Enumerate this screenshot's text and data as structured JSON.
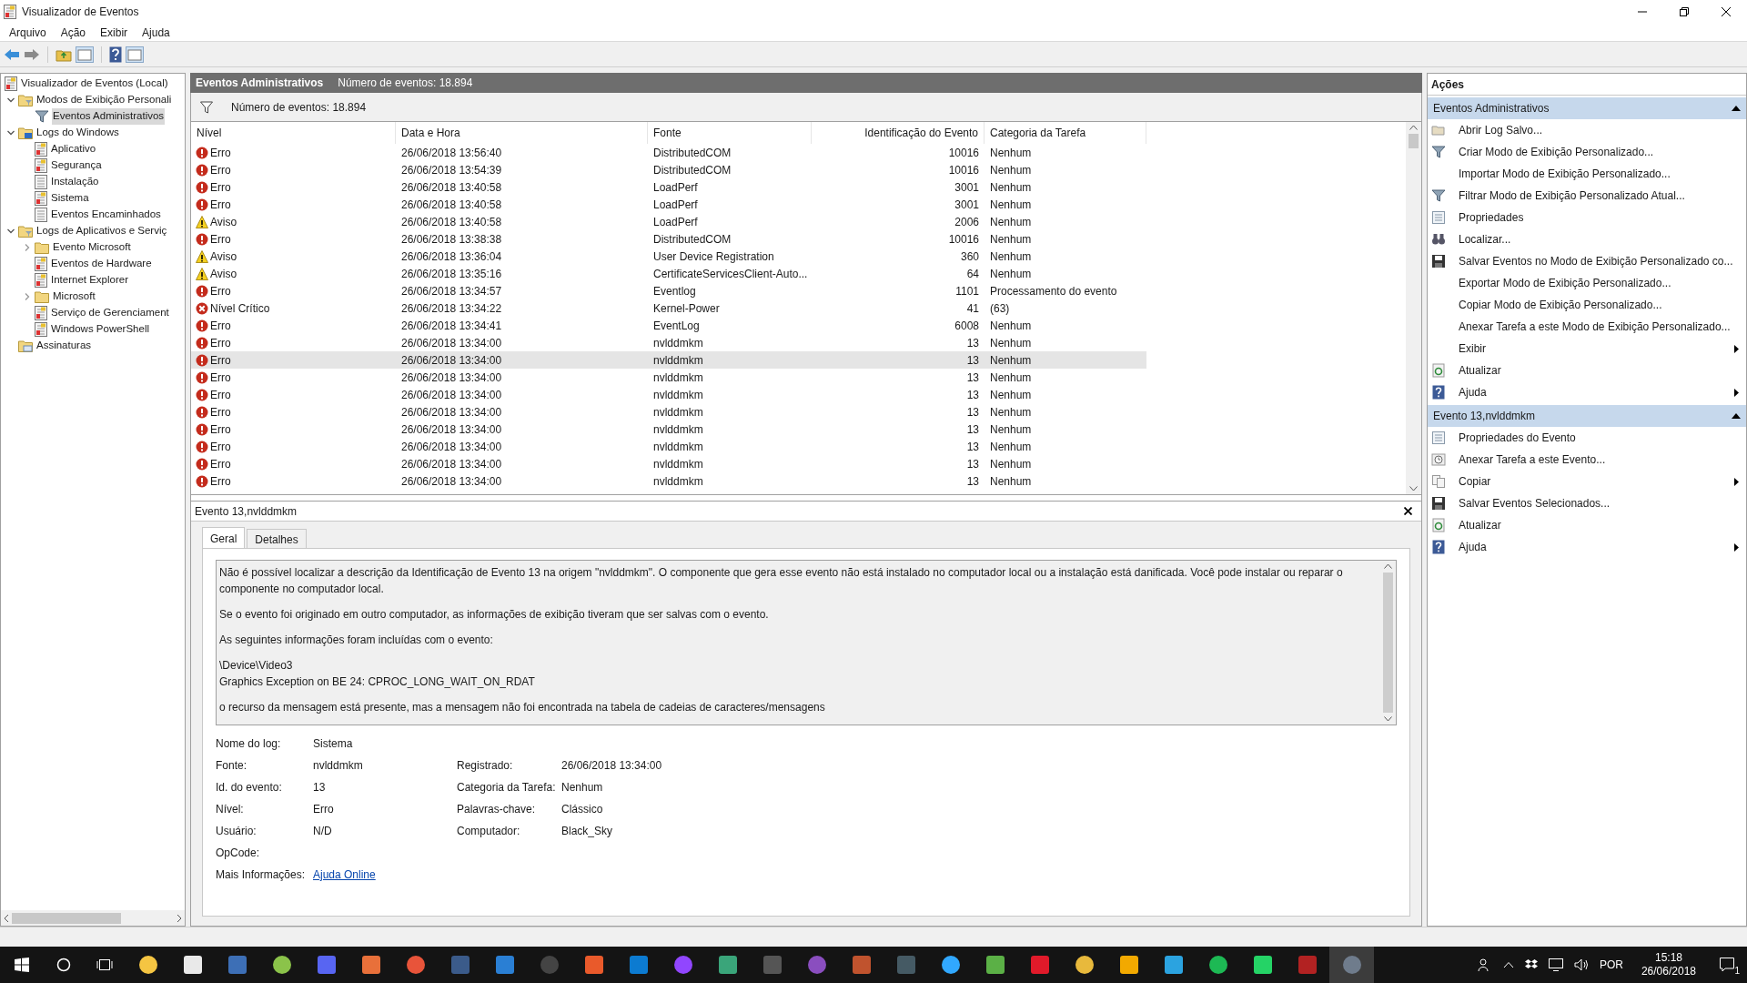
{
  "window": {
    "title": "Visualizador de Eventos"
  },
  "menu": [
    {
      "label": "Arquivo"
    },
    {
      "label": "Ação"
    },
    {
      "label": "Exibir"
    },
    {
      "label": "Ajuda"
    }
  ],
  "tree": [
    {
      "label": "Visualizador de Eventos (Local)",
      "kind": "root",
      "selected": false,
      "children": [
        {
          "label": "Modos de Exibição Personali",
          "kind": "custom-folder",
          "selected": false,
          "expanded": true,
          "children": [
            {
              "label": "Eventos Administrativos",
              "kind": "filter",
              "selected": true
            }
          ]
        },
        {
          "label": "Logs do Windows",
          "kind": "windows-folder",
          "selected": false,
          "expanded": true,
          "children": [
            {
              "label": "Aplicativo",
              "kind": "log",
              "selected": false
            },
            {
              "label": "Segurança",
              "kind": "log",
              "selected": false
            },
            {
              "label": "Instalação",
              "kind": "plain-log",
              "selected": false
            },
            {
              "label": "Sistema",
              "kind": "log",
              "selected": false
            },
            {
              "label": "Eventos Encaminhados",
              "kind": "plain-log",
              "selected": false
            }
          ]
        },
        {
          "label": "Logs de Aplicativos e Serviç",
          "kind": "custom-folder",
          "selected": false,
          "expanded": true,
          "children": [
            {
              "label": "Evento Microsoft",
              "kind": "folder",
              "selected": false,
              "expanded": false
            },
            {
              "label": "Eventos de Hardware",
              "kind": "log",
              "selected": false
            },
            {
              "label": "Internet Explorer",
              "kind": "log",
              "selected": false
            },
            {
              "label": "Microsoft",
              "kind": "folder",
              "selected": false,
              "expanded": false
            },
            {
              "label": "Serviço de Gerenciament",
              "kind": "log",
              "selected": false
            },
            {
              "label": "Windows PowerShell",
              "kind": "log",
              "selected": false
            }
          ]
        },
        {
          "label": "Assinaturas",
          "kind": "subscriptions",
          "selected": false
        }
      ]
    }
  ],
  "center": {
    "title": "Eventos Administrativos",
    "count": "Número de eventos: 18.894",
    "filter_count": "Número de eventos: 18.894",
    "table": {
      "columns": [
        "Nível",
        "Data e Hora",
        "Fonte",
        "Identificação do Evento",
        "Categoria da Tarefa"
      ],
      "rows": [
        {
          "kind": "error",
          "severity": "Erro",
          "date": "26/06/2018 13:56:40",
          "source": "DistributedCOM",
          "event_id": "10016",
          "category": "Nenhum",
          "selected": false
        },
        {
          "kind": "error",
          "severity": "Erro",
          "date": "26/06/2018 13:54:39",
          "source": "DistributedCOM",
          "event_id": "10016",
          "category": "Nenhum",
          "selected": false
        },
        {
          "kind": "error",
          "severity": "Erro",
          "date": "26/06/2018 13:40:58",
          "source": "LoadPerf",
          "event_id": "3001",
          "category": "Nenhum",
          "selected": false
        },
        {
          "kind": "error",
          "severity": "Erro",
          "date": "26/06/2018 13:40:58",
          "source": "LoadPerf",
          "event_id": "3001",
          "category": "Nenhum",
          "selected": false
        },
        {
          "kind": "warning",
          "severity": "Aviso",
          "date": "26/06/2018 13:40:58",
          "source": "LoadPerf",
          "event_id": "2006",
          "category": "Nenhum",
          "selected": false
        },
        {
          "kind": "error",
          "severity": "Erro",
          "date": "26/06/2018 13:38:38",
          "source": "DistributedCOM",
          "event_id": "10016",
          "category": "Nenhum",
          "selected": false
        },
        {
          "kind": "warning",
          "severity": "Aviso",
          "date": "26/06/2018 13:36:04",
          "source": "User Device Registration",
          "event_id": "360",
          "category": "Nenhum",
          "selected": false
        },
        {
          "kind": "warning",
          "severity": "Aviso",
          "date": "26/06/2018 13:35:16",
          "source": "CertificateServicesClient-Auto...",
          "event_id": "64",
          "category": "Nenhum",
          "selected": false
        },
        {
          "kind": "error",
          "severity": "Erro",
          "date": "26/06/2018 13:34:57",
          "source": "Eventlog",
          "event_id": "1101",
          "category": "Processamento do evento",
          "selected": false
        },
        {
          "kind": "critical",
          "severity": "Nível Crítico",
          "date": "26/06/2018 13:34:22",
          "source": "Kernel-Power",
          "event_id": "41",
          "category": "(63)",
          "selected": false
        },
        {
          "kind": "error",
          "severity": "Erro",
          "date": "26/06/2018 13:34:41",
          "source": "EventLog",
          "event_id": "6008",
          "category": "Nenhum",
          "selected": false
        },
        {
          "kind": "error",
          "severity": "Erro",
          "date": "26/06/2018 13:34:00",
          "source": "nvlddmkm",
          "event_id": "13",
          "category": "Nenhum",
          "selected": false
        },
        {
          "kind": "error",
          "severity": "Erro",
          "date": "26/06/2018 13:34:00",
          "source": "nvlddmkm",
          "event_id": "13",
          "category": "Nenhum",
          "selected": true
        },
        {
          "kind": "error",
          "severity": "Erro",
          "date": "26/06/2018 13:34:00",
          "source": "nvlddmkm",
          "event_id": "13",
          "category": "Nenhum",
          "selected": false
        },
        {
          "kind": "error",
          "severity": "Erro",
          "date": "26/06/2018 13:34:00",
          "source": "nvlddmkm",
          "event_id": "13",
          "category": "Nenhum",
          "selected": false
        },
        {
          "kind": "error",
          "severity": "Erro",
          "date": "26/06/2018 13:34:00",
          "source": "nvlddmkm",
          "event_id": "13",
          "category": "Nenhum",
          "selected": false
        },
        {
          "kind": "error",
          "severity": "Erro",
          "date": "26/06/2018 13:34:00",
          "source": "nvlddmkm",
          "event_id": "13",
          "category": "Nenhum",
          "selected": false
        },
        {
          "kind": "error",
          "severity": "Erro",
          "date": "26/06/2018 13:34:00",
          "source": "nvlddmkm",
          "event_id": "13",
          "category": "Nenhum",
          "selected": false
        },
        {
          "kind": "error",
          "severity": "Erro",
          "date": "26/06/2018 13:34:00",
          "source": "nvlddmkm",
          "event_id": "13",
          "category": "Nenhum",
          "selected": false
        },
        {
          "kind": "error",
          "severity": "Erro",
          "date": "26/06/2018 13:34:00",
          "source": "nvlddmkm",
          "event_id": "13",
          "category": "Nenhum",
          "selected": false
        }
      ]
    },
    "details": {
      "title": "Evento 13,nvlddmkm",
      "tabs": [
        {
          "label": "Geral",
          "selected": true
        },
        {
          "label": "Detalhes",
          "selected": false
        }
      ],
      "description": [
        [
          "Não é possível localizar a descrição da Identificação de Evento 13 na origem \"nvlddmkm\". O componente que gera esse evento não está instalado no computador local ou a instalação está danificada. Você pode instalar ou reparar o componente no computador local."
        ],
        [
          "Se o evento foi originado em outro computador, as informações de exibição tiveram que ser salvas com o evento."
        ],
        [
          "As seguintes informações foram incluídas com o evento:"
        ],
        [
          "\\Device\\Video3",
          "Graphics Exception on BE 24: CPROC_LONG_WAIT_ON_RDAT"
        ],
        [
          "o recurso da mensagem está presente, mas a mensagem não foi encontrada na tabela de cadeias de caracteres/mensagens"
        ]
      ],
      "fields": [
        {
          "label": "Nome do log:",
          "value": "Sistema"
        },
        {
          "label": "Fonte:",
          "value": "nvlddmkm",
          "right_label": "Registrado:",
          "right_value": "26/06/2018 13:34:00"
        },
        {
          "label": "Id. do evento:",
          "value": "13",
          "right_label": "Categoria da Tarefa:",
          "right_value": "Nenhum"
        },
        {
          "label": "Nível:",
          "value": "Erro",
          "right_label": "Palavras-chave:",
          "right_value": "Clássico"
        },
        {
          "label": "Usuário:",
          "value": "N/D",
          "right_label": "Computador:",
          "right_value": "Black_Sky"
        },
        {
          "label": "OpCode:"
        },
        {
          "label": "Mais Informações:",
          "link": "Ajuda Online"
        }
      ]
    }
  },
  "actions": {
    "title": "Ações",
    "sections": [
      {
        "title": "Eventos Administrativos",
        "expanded": true,
        "items": [
          {
            "label": "Abrir Log Salvo...",
            "kind": "open",
            "submenu": false
          },
          {
            "label": "Criar Modo de Exibição Personalizado...",
            "kind": "filter",
            "submenu": false
          },
          {
            "label": "Importar Modo de Exibição Personalizado...",
            "kind": "none",
            "submenu": false
          },
          {
            "label": "Filtrar Modo de Exibição Personalizado Atual...",
            "kind": "filter",
            "submenu": false
          },
          {
            "label": "Propriedades",
            "kind": "properties",
            "submenu": false
          },
          {
            "label": "Localizar...",
            "kind": "find",
            "submenu": false
          },
          {
            "label": "Salvar Eventos no Modo de Exibição Personalizado co...",
            "kind": "save",
            "submenu": false
          },
          {
            "label": "Exportar Modo de Exibição Personalizado...",
            "kind": "none",
            "submenu": false
          },
          {
            "label": "Copiar Modo de Exibição Personalizado...",
            "kind": "none",
            "submenu": false
          },
          {
            "label": "Anexar Tarefa a este Modo de Exibição Personalizado...",
            "kind": "none",
            "submenu": false
          },
          {
            "label": "Exibir",
            "kind": "none",
            "submenu": true
          },
          {
            "label": "Atualizar",
            "kind": "refresh",
            "submenu": false
          },
          {
            "label": "Ajuda",
            "kind": "help",
            "submenu": true
          }
        ]
      },
      {
        "title": "Evento 13,nvlddmkm",
        "expanded": true,
        "items": [
          {
            "label": "Propriedades do Evento",
            "kind": "properties",
            "submenu": false
          },
          {
            "label": "Anexar Tarefa a este Evento...",
            "kind": "task",
            "submenu": false
          },
          {
            "label": "Copiar",
            "kind": "copy",
            "submenu": true
          },
          {
            "label": "Salvar Eventos Selecionados...",
            "kind": "save",
            "submenu": false
          },
          {
            "label": "Atualizar",
            "kind": "refresh",
            "submenu": false
          },
          {
            "label": "Ajuda",
            "kind": "help",
            "submenu": true
          }
        ]
      }
    ]
  },
  "taskbar": {
    "language": "POR",
    "time": "15:18",
    "date": "26/06/2018",
    "notifications": "1"
  }
}
